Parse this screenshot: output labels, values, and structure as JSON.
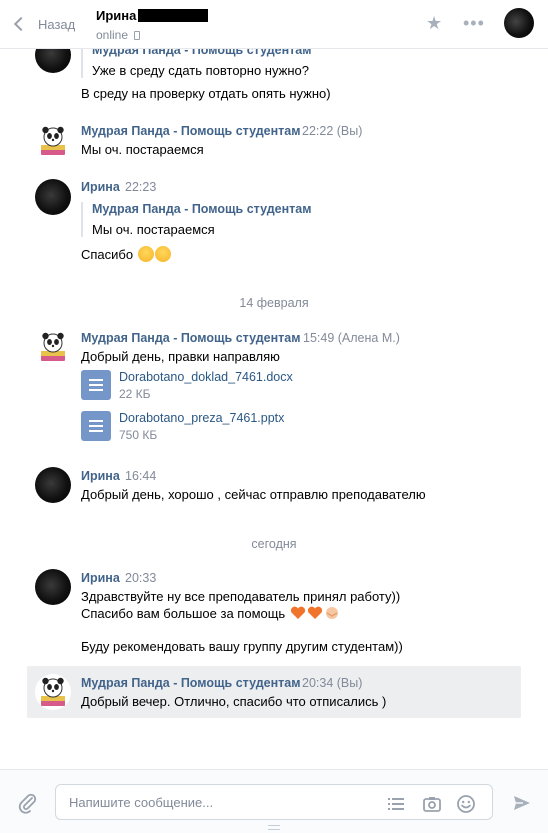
{
  "header": {
    "back_label": "Назад",
    "peer_name": "Ирина",
    "peer_status": "online",
    "icons": [
      "chevron-left-icon",
      "star-icon",
      "more-icon",
      "phone-icon"
    ]
  },
  "history": {
    "m0": {
      "quote_author": "Мудрая Панда - Помощь студентам",
      "quote_text": "Уже в среду сдать повторно нужно?",
      "text": "В среду на проверку отдать опять нужно)"
    },
    "m1": {
      "author": "Мудрая Панда - Помощь студентам",
      "time": "22:22",
      "sender_note": "(Вы)",
      "text": "Мы оч. постараемся"
    },
    "m2": {
      "author": "Ирина",
      "time": "22:23",
      "quote_author": "Мудрая Панда - Помощь студентам",
      "quote_text": "Мы оч. постараемся",
      "text": "Спасибо"
    },
    "divider1": "14 февраля",
    "m3": {
      "author": "Мудрая Панда - Помощь студентам",
      "time": "15:49",
      "sender_note": "(Алена М.)",
      "text": "Добрый день, правки направляю",
      "docs": [
        {
          "name": "Dorabotano_doklad_7461.docx",
          "size": "22 КБ"
        },
        {
          "name": "Dorabotano_preza_7461.pptx",
          "size": "750 КБ"
        }
      ]
    },
    "m4": {
      "author": "Ирина",
      "time": "16:44",
      "text": "Добрый день, хорошо , сейчас отправлю преподавателю"
    },
    "divider2": "сегодня",
    "m5": {
      "author": "Ирина",
      "time": "20:33",
      "line1": "Здравствуйте ну все преподаватель принял работу))",
      "line2": "Спасибо вам большое за помощь",
      "line3": "Буду рекомендовать вашу группу другим студентам))"
    },
    "m6": {
      "author": "Мудрая Панда - Помощь студентам",
      "time": "20:34",
      "sender_note": "(Вы)",
      "text": "Добрый вечер. Отлично, спасибо что отписались )"
    }
  },
  "composer": {
    "placeholder": "Напишите сообщение...",
    "icons": [
      "paperclip-icon",
      "template-list-icon",
      "camera-icon",
      "smile-icon",
      "send-icon"
    ]
  },
  "colors": {
    "link": "#2a5885",
    "author": "#42648b",
    "muted": "#828a99",
    "doc_icon": "#7596c8",
    "selected_bg": "#edeef0"
  }
}
